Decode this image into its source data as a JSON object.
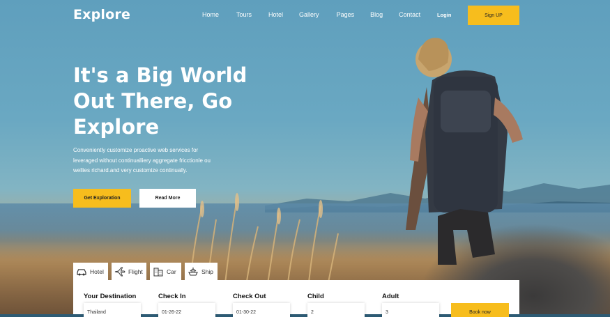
{
  "brand": {
    "logo": "Explore",
    "accent": "#f7bd1d"
  },
  "nav": {
    "items": [
      "Home",
      "Tours",
      "Hotel",
      "Gallery",
      "Pages",
      "Blog",
      "Contact"
    ],
    "login": "Login",
    "signup": "Sign UP"
  },
  "hero": {
    "headline_lines": [
      "It's a Big World",
      "Out There, Go",
      "Explore"
    ],
    "sub_lines": [
      "Conveniently customize proactive web services for",
      "leveraged without continualliery aggregate fricctionle ou",
      "wellies richard.and very customize continually."
    ],
    "primary_button": "Get Exploration",
    "secondary_button": "Read More"
  },
  "search": {
    "tabs": [
      {
        "icon": "car-icon",
        "label": "Hotel"
      },
      {
        "icon": "plane-icon",
        "label": "Flight"
      },
      {
        "icon": "building-icon",
        "label": "Car"
      },
      {
        "icon": "ship-icon",
        "label": "Ship"
      }
    ],
    "fields": [
      {
        "label": "Your Destination",
        "value": "Thailand"
      },
      {
        "label": "Check In",
        "value": "01-26-22"
      },
      {
        "label": "Check Out",
        "value": "01-30-22"
      },
      {
        "label": "Child",
        "value": "2"
      },
      {
        "label": "Adult",
        "value": "3"
      }
    ],
    "book_button": "Book now"
  }
}
